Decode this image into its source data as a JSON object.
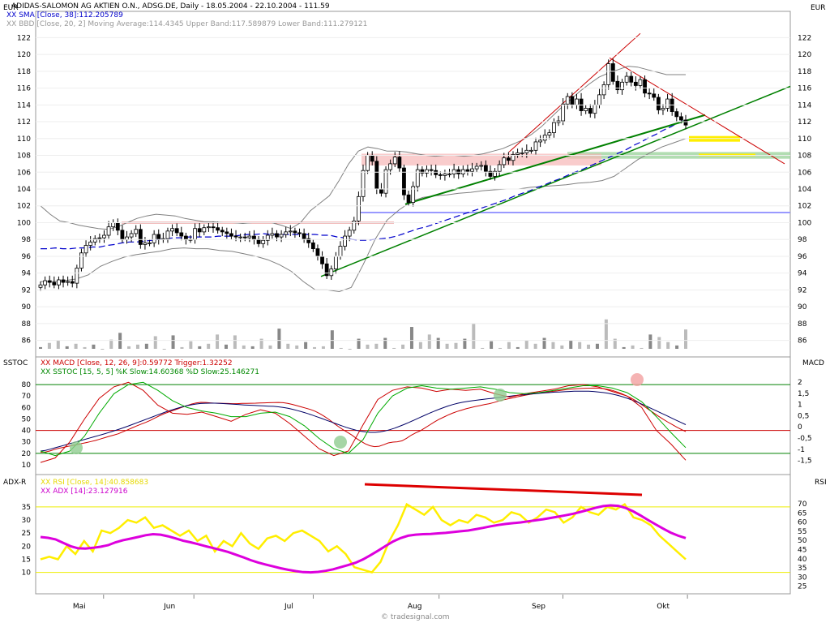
{
  "header": {
    "title": "ADIDAS-SALOMON AG AKTIEN O.N., ADSG.DE, Daily - 18.05.2004 - 22.10.2004 - 111.59",
    "sma": "XX SMA [Close, 38]:112.205789",
    "bbd": "XX BBD [Close, 20, 2] Moving Average:114.4345 Upper Band:117.589879 Lower Band:111.279121",
    "unit_left": "EUR",
    "unit_right": "EUR"
  },
  "macd_panel": {
    "label_left": "SSTOC",
    "label_right": "MACD",
    "macd_legend": "XX MACD [Close, 12, 26, 9]:0.59772 Trigger:1.32252",
    "sstoc_legend": "XX SSTOC [15, 5, 5] %K Slow:14.60368 %D Slow:25.146271"
  },
  "rsi_panel": {
    "label_left": "ADX-R",
    "label_right": "RSI",
    "rsi_legend": "XX RSI [Close, 14]:40.858683",
    "adx_legend": "XX ADX [14]:23.127916"
  },
  "footer": {
    "credit": "© tradesignal.com"
  },
  "colors": {
    "up": "#ffffff",
    "down": "#000000",
    "sma": "#0000cc",
    "bands": "#808080",
    "macd": "#cc0000",
    "trigger": "#000066",
    "sstoc_k": "#cc0000",
    "sstoc_d": "#00aa00",
    "rsi": "#ffee00",
    "adx": "#dd00dd",
    "trend": "#008000",
    "resistance": "#cc0000"
  },
  "chart_data": [
    {
      "type": "candlestick",
      "title": "ADIDAS-SALOMON AG AKTIEN O.N., ADSG.DE, Daily",
      "x_labels": [
        "Mai",
        "Jun",
        "Jul",
        "Aug",
        "Sep",
        "Okt"
      ],
      "ylim": [
        85,
        123
      ],
      "y_ticks": [
        86,
        88,
        90,
        92,
        94,
        96,
        98,
        100,
        102,
        104,
        106,
        108,
        110,
        112,
        114,
        116,
        118,
        120,
        122
      ],
      "close": [
        92.6,
        93.1,
        92.9,
        92.6,
        93.2,
        92.9,
        93.0,
        92.8,
        94.6,
        96.4,
        97.3,
        97.7,
        98.1,
        98.2,
        98.5,
        99.5,
        100.0,
        99.1,
        98.0,
        98.3,
        98.7,
        99.2,
        97.4,
        97.6,
        97.6,
        98.6,
        98.0,
        98.1,
        99.0,
        99.3,
        98.8,
        98.4,
        98.0,
        98.0,
        99.3,
        98.9,
        99.4,
        99.5,
        99.4,
        99.1,
        98.9,
        98.7,
        98.4,
        98.3,
        98.3,
        98.2,
        98.4,
        98.0,
        97.5,
        97.9,
        98.5,
        98.7,
        98.3,
        98.6,
        98.9,
        99.0,
        98.8,
        98.7,
        98.1,
        97.6,
        96.9,
        96.0,
        95.1,
        93.7,
        94.5,
        96.0,
        97.2,
        98.4,
        99.1,
        100.2,
        103.1,
        106.2,
        108.0,
        107.3,
        104.0,
        103.5,
        106.3,
        107.0,
        107.8,
        106.5,
        103.3,
        102.4,
        104.3,
        106.3,
        105.9,
        106.3,
        106.2,
        105.7,
        105.6,
        105.8,
        105.8,
        106.3,
        105.8,
        106.3,
        106.1,
        106.4,
        106.7,
        106.8,
        106.1,
        105.5,
        106.1,
        106.9,
        107.7,
        107.4,
        108.1,
        108.3,
        108.3,
        108.6,
        108.6,
        109.6,
        109.8,
        110.4,
        110.7,
        111.9,
        112.1,
        114.1,
        115.0,
        114.0,
        114.7,
        113.3,
        113.6,
        113.0,
        114.0,
        115.2,
        116.4,
        118.9,
        116.8,
        115.8,
        116.7,
        117.4,
        116.7,
        116.3,
        117.0,
        115.4,
        115.3,
        114.9,
        113.4,
        113.6,
        114.7,
        113.2,
        112.6,
        112.2,
        111.6
      ],
      "sma_38": [
        96.9,
        96.9,
        97.0,
        96.9,
        96.9,
        97.0,
        97.0,
        97.1,
        97.1,
        97.3,
        97.4,
        97.6,
        97.7,
        97.7,
        97.8,
        97.9,
        98.0,
        98.1,
        98.2,
        98.2,
        98.3,
        98.3,
        98.3,
        98.3,
        98.4,
        98.4,
        98.4,
        98.5,
        98.6,
        98.6,
        98.7,
        98.6,
        98.6,
        98.6,
        98.6,
        98.6,
        98.6,
        98.6,
        98.5,
        98.5,
        98.3,
        98.2,
        98.0,
        97.9,
        97.9,
        98.0,
        98.1,
        98.2,
        98.4,
        98.7,
        99.0,
        99.3,
        99.5,
        99.8,
        100.1,
        100.4,
        100.7,
        101.0,
        101.3,
        101.6,
        101.9,
        102.2,
        102.5,
        102.8,
        103.2,
        103.5,
        103.8,
        104.2,
        104.5,
        104.9,
        105.2,
        105.6,
        106.0,
        106.3,
        106.7,
        107.1,
        107.5,
        107.9,
        108.3,
        108.7,
        109.2,
        109.6,
        110.1,
        110.5,
        111.0,
        111.4,
        111.9,
        112.2
      ],
      "bb_upper": [
        102.0,
        101.0,
        100.2,
        100.0,
        99.7,
        99.5,
        99.3,
        99.2,
        99.5,
        100.0,
        100.5,
        100.8,
        101.0,
        100.9,
        100.8,
        100.5,
        100.3,
        100.1,
        100.1,
        100.0,
        100.0,
        99.9,
        100.0,
        100.0,
        100.0,
        99.7,
        99.3,
        100.0,
        101.4,
        102.3,
        103.2,
        105.0,
        107.0,
        108.5,
        109.0,
        108.8,
        108.5,
        108.5,
        108.4,
        108.2,
        108.0,
        107.9,
        108.0,
        108.0,
        107.9,
        108.0,
        108.2,
        108.5,
        108.8,
        109.3,
        109.8,
        110.5,
        111.4,
        112.5,
        113.6,
        114.6,
        115.6,
        116.5,
        117.3,
        117.8,
        118.2,
        118.6,
        118.5,
        118.2,
        117.9,
        117.6,
        117.6,
        117.6
      ],
      "bb_lower": [
        93.0,
        93.0,
        93.1,
        93.3,
        93.8,
        94.8,
        95.4,
        95.9,
        96.2,
        96.4,
        96.6,
        96.9,
        97.0,
        96.9,
        96.9,
        96.7,
        96.6,
        96.3,
        96.0,
        95.6,
        95.0,
        94.2,
        93.0,
        92.0,
        92.0,
        91.8,
        92.3,
        95.0,
        98.0,
        100.3,
        101.5,
        102.5,
        103.0,
        103.2,
        103.3,
        103.5,
        103.6,
        103.8,
        103.9,
        104.0,
        104.0,
        104.2,
        104.3,
        104.4,
        104.5,
        104.7,
        104.8,
        105.0,
        105.5,
        106.5,
        107.5,
        108.3,
        109.0,
        109.5,
        110.0
      ],
      "volume": [
        85.2,
        85.7,
        86.0,
        85.3,
        85.6,
        85.2,
        85.5,
        85.0,
        86.1,
        86.9,
        85.3,
        85.5,
        85.6,
        86.5,
        85.0,
        86.6,
        85.2,
        85.9,
        85.3,
        85.6,
        86.7,
        85.5,
        86.6,
        85.4,
        85.3,
        86.2,
        85.4,
        87.4,
        85.6,
        85.4,
        85.8,
        85.2,
        85.3,
        87.2,
        85.1,
        85.0,
        86.2,
        85.5,
        85.6,
        86.3,
        85.1,
        85.5,
        87.6,
        85.8,
        86.7,
        86.3,
        85.6,
        85.7,
        86.2,
        88.0,
        85.1,
        85.9,
        85.1,
        85.8,
        85.2,
        86.0,
        85.6,
        86.3,
        85.8,
        85.4,
        86.0,
        85.8,
        85.5,
        85.6,
        88.5,
        86.2,
        85.2,
        85.4,
        85.1,
        86.7,
        86.4,
        85.8,
        85.4,
        87.3
      ],
      "annotations": {
        "resistance_levels": [
          100.0,
          108.1,
          106.9,
          112.0,
          101.2
        ],
        "support_zone": [
          107.6,
          108.4
        ]
      }
    },
    {
      "type": "line",
      "title": "SSTOC / MACD",
      "x_labels": [
        "Mai",
        "Jun",
        "Jul",
        "Aug",
        "Sep",
        "Okt"
      ],
      "left_ticks": [
        10,
        20,
        30,
        40,
        50,
        60,
        70,
        80
      ],
      "right_ticks": [
        "2",
        "1,5",
        "1",
        "0,5",
        "0",
        "-0,5",
        "-1",
        "-1,5"
      ],
      "ylim": [
        5,
        90
      ],
      "series": [
        {
          "name": "MACD",
          "values": [
            21.0,
            21.1,
            22.0,
            23.3,
            24.4,
            25.2,
            26.1,
            26.9,
            27.7,
            28.5,
            29.4,
            30.3,
            31.2,
            32.4,
            33.6,
            34.8,
            35.9,
            37.1,
            38.8,
            40.5,
            42.2,
            43.9,
            45.5,
            47.0,
            48.8,
            50.8,
            52.8,
            54.6,
            56.1,
            57.4,
            58.8,
            60.3,
            61.7,
            63.0,
            64.0,
            64.5,
            64.4,
            64.1,
            63.8,
            63.7,
            63.6,
            63.5,
            63.4,
            63.4,
            63.6,
            63.6,
            63.7,
            63.8,
            64.0,
            64.1,
            64.2,
            64.3,
            64.4,
            64.2,
            63.6,
            62.7,
            61.7,
            60.5,
            59.4,
            58.3,
            56.8,
            54.7,
            52.3,
            49.6,
            46.6,
            43.6,
            40.9,
            38.5,
            36.0,
            33.1,
            30.6,
            28.2,
            26.6,
            25.8,
            26.2,
            27.5,
            29.1,
            29.8,
            30.1,
            30.9,
            33.1,
            35.8,
            37.9,
            39.7,
            42.1,
            44.7,
            47.2,
            49.5,
            51.4,
            53.3,
            55.0,
            56.5,
            57.7,
            58.9,
            59.9,
            60.9,
            61.7,
            62.5,
            63.3,
            64.3,
            65.4,
            66.5,
            67.4,
            68.2,
            69.2,
            70.0,
            70.8,
            71.5,
            72.1,
            72.6,
            73.2,
            73.7,
            74.1,
            74.6,
            75.1,
            75.6,
            76.1,
            76.4,
            76.6,
            76.8,
            76.9,
            77.0,
            76.9,
            76.5,
            75.8,
            74.9,
            73.6,
            72.1,
            70.3,
            68.3,
            66.1,
            63.5,
            60.8,
            58.0,
            55.2,
            52.5,
            49.9,
            47.5,
            45.2,
            43.0,
            40.9,
            39.0
          ],
          "trigger_values": [
            22.0,
            22.6,
            23.6,
            24.8,
            26.0,
            27.2,
            28.4,
            29.6,
            30.8,
            32.0,
            33.2,
            34.4,
            35.6,
            36.8,
            38.1,
            39.4,
            40.8,
            42.2,
            43.7,
            45.3,
            46.9,
            48.5,
            50.1,
            51.7,
            53.3,
            54.9,
            56.4,
            57.8,
            59.1,
            60.3,
            61.4,
            62.3,
            63.0,
            63.5,
            63.7,
            63.8,
            63.8,
            63.6,
            63.4,
            63.1,
            62.8,
            62.5,
            62.2,
            62.0,
            61.8,
            61.6,
            61.4,
            61.2,
            61.0,
            60.6,
            60.1,
            59.3,
            58.4,
            57.3,
            56.1,
            54.8,
            53.4,
            51.9,
            50.4,
            48.8,
            47.3,
            45.7,
            44.2,
            42.7,
            41.4,
            40.3,
            39.3,
            38.7,
            38.3,
            38.3,
            38.7,
            39.5,
            40.6,
            42.0,
            43.6,
            45.3,
            47.1,
            49.0,
            50.9,
            52.8,
            54.7,
            56.5,
            58.2,
            59.8,
            61.3,
            62.6,
            63.7,
            64.6,
            65.3,
            65.9,
            66.5,
            67.0,
            67.5,
            68.0,
            68.5,
            69.0,
            69.5,
            70.0,
            70.5,
            70.9,
            71.3,
            71.7,
            72.1,
            72.5,
            72.8,
            73.1,
            73.4,
            73.6,
            73.8,
            74.0,
            74.2,
            74.3,
            74.3,
            74.2,
            74.0,
            73.6,
            73.1,
            72.4,
            71.6,
            70.6,
            69.4,
            68.0,
            66.4,
            64.7,
            62.9,
            61.0,
            59.0,
            57.0,
            55.0,
            53.0,
            51.0,
            49.0,
            47.0,
            45.0
          ]
        },
        {
          "name": "%K Slow",
          "values": [
            12.0,
            16.0,
            30.0,
            50.0,
            68.0,
            78.0,
            82.0,
            75.0,
            62.0,
            55.0,
            54.0,
            56.0,
            52.0,
            48.0,
            54.0,
            58.0,
            55.0,
            46.0,
            35.0,
            24.0,
            18.0,
            22.0,
            45.0,
            67.0,
            75.0,
            78.0,
            77.0,
            74.0,
            76.0,
            75.0,
            76.0,
            72.0,
            69.0,
            72.0,
            74.0,
            76.0,
            79.0,
            80.0,
            78.0,
            74.0,
            70.0,
            60.0,
            40.0,
            28.0,
            14.0
          ]
        },
        {
          "name": "%D Slow",
          "values": [
            22.0,
            18.0,
            22.0,
            35.0,
            55.0,
            72.0,
            80.0,
            82.0,
            75.0,
            66.0,
            60.0,
            57.0,
            55.0,
            52.0,
            52.0,
            55.0,
            56.0,
            52.0,
            44.0,
            33.0,
            24.0,
            20.0,
            32.0,
            55.0,
            70.0,
            77.0,
            79.0,
            77.0,
            76.0,
            77.0,
            78.0,
            76.0,
            73.0,
            72.0,
            73.0,
            75.0,
            77.0,
            79.0,
            79.0,
            77.0,
            73.0,
            65.0,
            52.0,
            38.0,
            25.0
          ]
        }
      ],
      "reference_lines": [
        80,
        40,
        20
      ]
    },
    {
      "type": "line",
      "title": "ADX-R / RSI",
      "x_labels": [
        "Mai",
        "Jun",
        "Jul",
        "Aug",
        "Sep",
        "Okt"
      ],
      "left_ticks": [
        10,
        15,
        20,
        25,
        30,
        35
      ],
      "right_ticks": [
        25,
        30,
        35,
        40,
        45,
        50,
        55,
        60,
        65,
        70
      ],
      "ylim": [
        4,
        39
      ],
      "series": [
        {
          "name": "RSI",
          "values": [
            15.0,
            16.0,
            15.0,
            20.0,
            17.0,
            22.0,
            18.0,
            26.0,
            25.0,
            27.0,
            30.0,
            29.0,
            31.0,
            27.0,
            28.0,
            26.0,
            24.0,
            26.0,
            22.0,
            24.0,
            18.0,
            22.0,
            20.0,
            25.0,
            21.0,
            19.0,
            23.0,
            24.0,
            22.0,
            25.0,
            26.0,
            24.0,
            22.0,
            18.0,
            20.0,
            17.0,
            12.0,
            11.0,
            10.0,
            14.0,
            22.0,
            28.0,
            36.0,
            34.0,
            32.0,
            35.0,
            30.0,
            28.0,
            30.0,
            29.0,
            32.0,
            31.0,
            29.0,
            30.0,
            33.0,
            32.0,
            29.0,
            31.0,
            34.0,
            33.0,
            29.0,
            31.0,
            35.0,
            33.0,
            32.0,
            35.0,
            34.0,
            36.0,
            31.0,
            30.0,
            28.0,
            24.0,
            21.0,
            18.0,
            15.0
          ]
        },
        {
          "name": "ADX",
          "values": [
            23.5,
            23.2,
            22.6,
            21.3,
            20.0,
            19.2,
            19.1,
            19.4,
            19.8,
            20.4,
            21.5,
            22.3,
            22.9,
            23.5,
            24.2,
            24.6,
            24.4,
            23.8,
            23.0,
            22.1,
            21.5,
            20.8,
            20.0,
            19.3,
            18.6,
            17.8,
            16.8,
            15.8,
            14.7,
            13.8,
            13.0,
            12.3,
            11.6,
            11.0,
            10.5,
            10.1,
            10.0,
            10.2,
            10.6,
            11.2,
            12.0,
            12.8,
            13.7,
            15.0,
            16.6,
            18.3,
            20.1,
            21.8,
            23.1,
            24.0,
            24.4,
            24.6,
            24.7,
            24.9,
            25.1,
            25.4,
            25.7,
            26.0,
            26.5,
            27.0,
            27.6,
            28.1,
            28.5,
            28.8,
            29.1,
            29.5,
            29.9,
            30.3,
            30.8,
            31.3,
            31.8,
            32.4,
            33.1,
            33.9,
            34.7,
            35.3,
            35.6,
            35.4,
            34.6,
            33.3,
            31.7,
            30.0,
            28.3,
            26.7,
            25.2,
            24.0,
            23.1
          ]
        }
      ],
      "reference_lines": [
        35,
        10
      ]
    }
  ]
}
